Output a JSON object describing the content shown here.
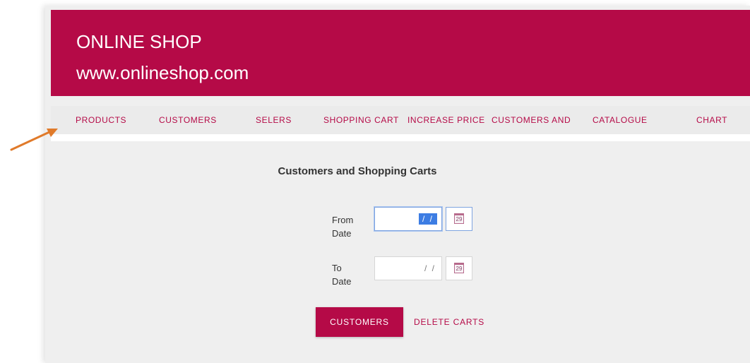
{
  "header": {
    "title": "ONLINE SHOP",
    "url": "www.onlineshop.com"
  },
  "nav": {
    "items": [
      {
        "label": "PRODUCTS"
      },
      {
        "label": "CUSTOMERS"
      },
      {
        "label": "SELERS"
      },
      {
        "label": "SHOPPING CART"
      },
      {
        "label": "INCREASE PRICE"
      },
      {
        "label": "CUSTOMERS AND"
      },
      {
        "label": "CATALOGUE"
      },
      {
        "label": "CHART"
      }
    ]
  },
  "form": {
    "title": "Customers and Shopping Carts",
    "from_label_line1": "From",
    "from_label_line2": "Date",
    "from_value": "/ /",
    "to_label_line1": "To",
    "to_label_line2": "Date",
    "to_value": "/ /",
    "calendar_day": "29"
  },
  "actions": {
    "customers_label": "CUSTOMERS",
    "delete_carts_label": "DELETE CARTS"
  },
  "colors": {
    "brand": "#b50a47",
    "annotation_arrow": "#e07a2a"
  }
}
